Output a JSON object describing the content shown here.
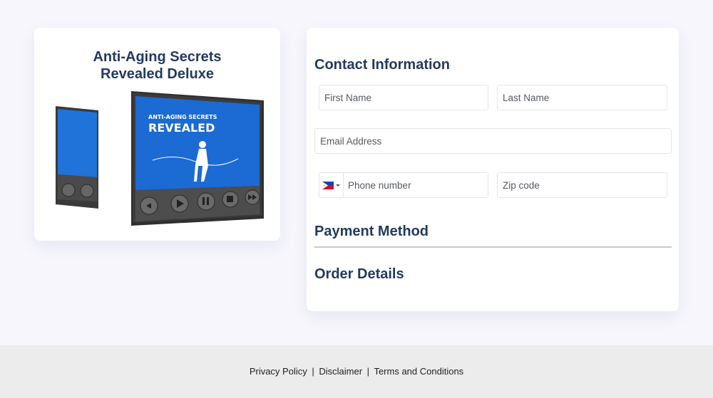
{
  "product": {
    "title_line1": "Anti-Aging Secrets",
    "title_line2": "Revealed Deluxe",
    "image_icon": "video-player-mockup-icon",
    "cover_title_line1": "ANTI-AGING SECRETS",
    "cover_title_line2": "REVEALED"
  },
  "form": {
    "contact_heading": "Contact Information",
    "first_name_placeholder": "First Name",
    "last_name_placeholder": "Last Name",
    "email_placeholder": "Email Address",
    "phone_placeholder": "Phone number",
    "phone_flag_icon": "philippines-flag-icon",
    "zip_placeholder": "Zip code",
    "payment_heading": "Payment Method",
    "order_heading": "Order Details"
  },
  "footer": {
    "privacy": "Privacy Policy",
    "disclaimer": "Disclaimer",
    "terms": "Terms and Conditions",
    "separator": "|"
  },
  "colors": {
    "heading": "#233a60",
    "screen_blue": "#1c6ad4",
    "footer_bg": "#ececec",
    "page_bg": "#f6f6fc"
  }
}
